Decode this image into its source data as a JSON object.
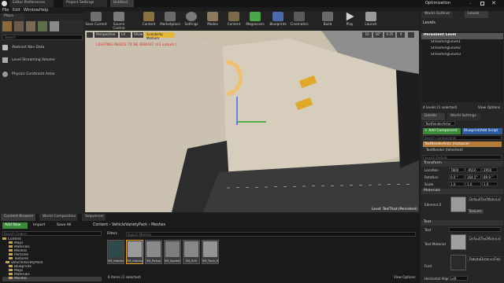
{
  "window": {
    "tabs": [
      "Editor Preferences",
      "Project Settings",
      "Untitled"
    ],
    "user": "Optimization"
  },
  "menu": [
    "File",
    "Edit",
    "Window",
    "Help"
  ],
  "modes": {
    "tab": "Place",
    "search_placeholder": "Search",
    "items": [
      "Abstract Nav Data",
      "Level Streaming Volume",
      "Physics Constraint Actor"
    ]
  },
  "toolbar": {
    "buttons": [
      "Save Current",
      "Source Control",
      "Content",
      "Marketplace",
      "Settings",
      "Modes",
      "Content",
      "Megascans",
      "Blueprints",
      "Cinematics",
      "Build",
      "Play",
      "Launch"
    ]
  },
  "viewport": {
    "perspective": "Perspective",
    "lit": "Lit",
    "show": "Show",
    "scalability": "Scalability: Medium",
    "warning": "LIGHTING NEEDS TO BE REBUILT (43 unbuilt )",
    "level_label": "Level:",
    "level_name": "TestThad (Persistent)",
    "snap_values": [
      "10",
      "10°",
      "0.25",
      "4"
    ]
  },
  "world_outliner": {
    "tabs": [
      "World Outliner",
      "Levels"
    ],
    "title": "Levels",
    "items": [
      "Persistent Level",
      "StreamingLevel1",
      "StreamingLevel2",
      "StreamingLevel3"
    ],
    "footer": "4 levels (1 selected)",
    "view_options": "View Options"
  },
  "details": {
    "tabs": [
      "Details",
      "World Settings"
    ],
    "name_value": "TextRenderActor",
    "actor_label": "TextRenderActor (Instance)",
    "component": "TextRender (Inherited)",
    "add_component": "+ Add Component",
    "blueprint": "Blueprint/Add Script",
    "search_placeholder": "Search Components",
    "search_details": "Search Details",
    "transform_header": "Transform",
    "location": "Location",
    "rotation": "Rotation",
    "scale": "Scale",
    "loc_vals": [
      "7800",
      "-9516",
      "2950"
    ],
    "rot_vals": [
      "0.0 °",
      "164.5°",
      "89.9 °"
    ],
    "scale_vals": [
      "1.0",
      "1.0",
      "1.0"
    ],
    "materials_header": "Materials",
    "element0": "Element 0",
    "material_name": "DefaultTextMaterialOpaque",
    "textures": "Textures",
    "text_header": "Text",
    "text_label": "Text",
    "text_value": "",
    "text_material": "Text Material",
    "text_material_name": "DefaultTextMaterialOpaque",
    "font": "Font",
    "font_name": "RobotoDistanceField",
    "halign": "Horizontal Alignment",
    "halign_value": "Left"
  },
  "bottom": {
    "tabs": [
      "Content Browser",
      "World Composition",
      "Sequencer"
    ],
    "add_new": "Add New",
    "import": "Import",
    "save_all": "Save All",
    "path": [
      "Content",
      "VehicleVarietyPack",
      "Meshes"
    ],
    "search_folders": "Search Folders",
    "filters": "Filters",
    "search_assets": "Search Meshes",
    "folders": [
      "Content",
      "Maps",
      "Materials",
      "Meshes",
      "Particles",
      "Textures",
      "VehicleVarietyPack",
      "Blueprints",
      "Maps",
      "Materials",
      "Meshes"
    ],
    "assets": [
      "SM_Hatchback",
      "SM_Hatchback",
      "SM_Pickup",
      "SM_SportsCar",
      "SM_SUV",
      "SM_Truck_Box"
    ],
    "status": "6 items (1 selected)",
    "view_options": "View Options"
  }
}
